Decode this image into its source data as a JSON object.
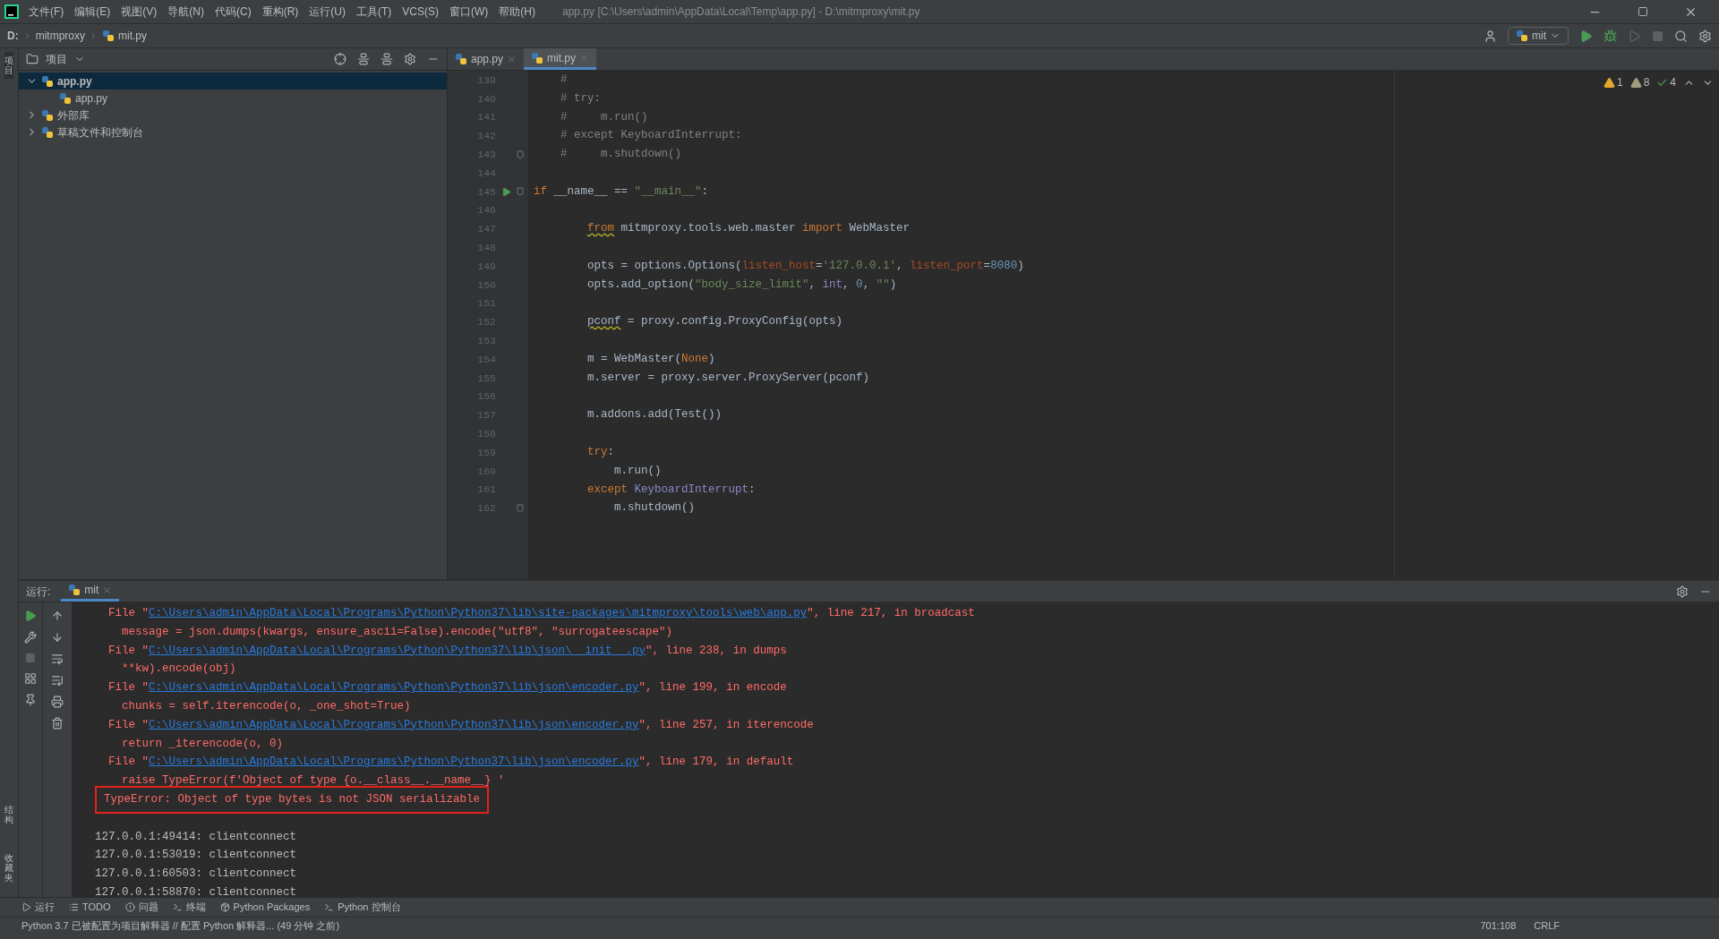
{
  "menu": [
    "文件(F)",
    "编辑(E)",
    "视图(V)",
    "导航(N)",
    "代码(C)",
    "重构(R)",
    "运行(U)",
    "工具(T)",
    "VCS(S)",
    "窗口(W)",
    "帮助(H)"
  ],
  "window": {
    "title": "app.py [C:\\Users\\admin\\AppData\\Local\\Temp\\app.py] - D:\\mitmproxy\\mit.py"
  },
  "breadcrumbs": [
    "D:",
    "mitmproxy",
    "mit.py"
  ],
  "run_config": "mit",
  "left_stripe": [
    {
      "label": "项目",
      "selected": true
    },
    {
      "label": "结构",
      "selected": false
    },
    {
      "label": "收藏夹",
      "selected": false
    }
  ],
  "project": {
    "title": "项目",
    "tree": [
      {
        "label": "app.py",
        "selected": true,
        "expanded": true,
        "children": [
          {
            "label": "app.py",
            "selected": false
          }
        ]
      },
      {
        "label": "外部库",
        "selected": false,
        "expanded": false
      },
      {
        "label": "草稿文件和控制台",
        "selected": false,
        "expanded": false
      }
    ]
  },
  "editor_tabs": [
    {
      "label": "app.py",
      "selected": false
    },
    {
      "label": "mit.py",
      "selected": true
    }
  ],
  "inspections": [
    {
      "kind": "warning",
      "count": "1"
    },
    {
      "kind": "weak",
      "count": "8"
    },
    {
      "kind": "typo",
      "count": "4"
    }
  ],
  "code": [
    {
      "number": "139",
      "kind": "level1",
      "run": false,
      "fold": false,
      "tokens": [
        {
          "kind": "comment",
          "text": "#"
        }
      ]
    },
    {
      "number": "140",
      "kind": "level1",
      "run": false,
      "fold": false,
      "tokens": [
        {
          "kind": "comment",
          "text": "# try:"
        }
      ]
    },
    {
      "number": "141",
      "kind": "level1",
      "run": false,
      "fold": false,
      "tokens": [
        {
          "kind": "comment",
          "text": "#     m.run()"
        }
      ]
    },
    {
      "number": "142",
      "kind": "level1",
      "run": false,
      "fold": false,
      "tokens": [
        {
          "kind": "comment",
          "text": "# except KeyboardInterrupt:"
        }
      ]
    },
    {
      "number": "143",
      "kind": "level1",
      "run": false,
      "fold": true,
      "tokens": [
        {
          "kind": "comment",
          "text": "#     m.shutdown()"
        }
      ]
    },
    {
      "number": "144",
      "kind": "top",
      "run": false,
      "fold": false
    },
    {
      "number": "145",
      "kind": "top",
      "run": true,
      "fold": true,
      "tokens": [
        {
          "kind": "keyword",
          "text": "if"
        },
        {
          "kind": "plain",
          "text": " __name__ == "
        },
        {
          "kind": "string",
          "text": "\"__main__\""
        },
        {
          "kind": "plain",
          "text": ":"
        }
      ]
    },
    {
      "number": "146",
      "kind": "top",
      "run": false,
      "fold": false
    },
    {
      "number": "147",
      "kind": "level2",
      "run": false,
      "fold": false,
      "tokens": [
        {
          "kind": "keyword",
          "text": "from",
          "warn": true
        },
        {
          "kind": "plain",
          "text": " mitmproxy.tools.web.master "
        },
        {
          "kind": "keyword",
          "text": "import"
        },
        {
          "kind": "plain",
          "text": " WebMaster"
        }
      ]
    },
    {
      "number": "148",
      "kind": "top",
      "run": false,
      "fold": false
    },
    {
      "number": "149",
      "kind": "level2",
      "run": false,
      "fold": false,
      "tokens": [
        {
          "kind": "plain",
          "text": "opts = options.Options("
        },
        {
          "kind": "param",
          "text": "listen_host"
        },
        {
          "kind": "plain",
          "text": "="
        },
        {
          "kind": "string",
          "text": "'127.0.0.1'"
        },
        {
          "kind": "plain",
          "text": ", "
        },
        {
          "kind": "param",
          "text": "listen_port"
        },
        {
          "kind": "plain",
          "text": "="
        },
        {
          "kind": "number",
          "text": "8080"
        },
        {
          "kind": "plain",
          "text": ")"
        }
      ]
    },
    {
      "number": "150",
      "kind": "level2",
      "run": false,
      "fold": false,
      "tokens": [
        {
          "kind": "plain",
          "text": "opts.add_option("
        },
        {
          "kind": "string",
          "text": "\"body_size_limit\""
        },
        {
          "kind": "plain",
          "text": ", "
        },
        {
          "kind": "builtin",
          "text": "int"
        },
        {
          "kind": "plain",
          "text": ", "
        },
        {
          "kind": "number",
          "text": "0"
        },
        {
          "kind": "plain",
          "text": ", "
        },
        {
          "kind": "string",
          "text": "\"\""
        },
        {
          "kind": "plain",
          "text": ")"
        }
      ]
    },
    {
      "number": "151",
      "kind": "top",
      "run": false,
      "fold": false
    },
    {
      "number": "152",
      "kind": "level2",
      "run": false,
      "fold": false,
      "tokens": [
        {
          "kind": "plain",
          "text": "pconf",
          "warn": true
        },
        {
          "kind": "plain",
          "text": " = proxy.config.ProxyConfig(opts)"
        }
      ]
    },
    {
      "number": "153",
      "kind": "top",
      "run": false,
      "fold": false
    },
    {
      "number": "154",
      "kind": "level2",
      "run": false,
      "fold": false,
      "tokens": [
        {
          "kind": "plain",
          "text": "m = WebMaster("
        },
        {
          "kind": "keyword",
          "text": "None"
        },
        {
          "kind": "plain",
          "text": ")"
        }
      ]
    },
    {
      "number": "155",
      "kind": "level2",
      "run": false,
      "fold": false,
      "tokens": [
        {
          "kind": "plain",
          "text": "m.server = proxy.server.ProxyServer(pconf)"
        }
      ]
    },
    {
      "number": "156",
      "kind": "top",
      "run": false,
      "fold": false
    },
    {
      "number": "157",
      "kind": "level2",
      "run": false,
      "fold": false,
      "tokens": [
        {
          "kind": "plain",
          "text": "m.addons.add(Test())"
        }
      ]
    },
    {
      "number": "158",
      "kind": "top",
      "run": false,
      "fold": false
    },
    {
      "number": "159",
      "kind": "level2",
      "run": false,
      "fold": false,
      "tokens": [
        {
          "kind": "keyword",
          "text": "try"
        },
        {
          "kind": "plain",
          "text": ":"
        }
      ]
    },
    {
      "number": "160",
      "kind": "level3",
      "run": false,
      "fold": false,
      "tokens": [
        {
          "kind": "plain",
          "text": "m.run()"
        }
      ]
    },
    {
      "number": "161",
      "kind": "level2",
      "run": false,
      "fold": false,
      "tokens": [
        {
          "kind": "keyword",
          "text": "except"
        },
        {
          "kind": "builtin",
          "text": " KeyboardInterrupt"
        },
        {
          "kind": "plain",
          "text": ":"
        }
      ]
    },
    {
      "number": "162",
      "kind": "level3",
      "run": false,
      "fold": true,
      "tokens": [
        {
          "kind": "plain",
          "text": "m.shutdown()"
        }
      ]
    }
  ],
  "run_panel": {
    "label": "运行:",
    "tab": "mit",
    "console": [
      {
        "kind": "file",
        "before": "File \"",
        "link": "C:\\Users\\admin\\AppData\\Local\\Programs\\Python\\Python37\\lib\\site-packages\\mitmproxy\\tools\\web\\app.py",
        "after": "\", line 217, in broadcast"
      },
      {
        "kind": "error",
        "text": "message = json.dumps(kwargs, ensure_ascii=False).encode(\"utf8\", \"surrogateescape\")"
      },
      {
        "kind": "file",
        "before": "File \"",
        "link": "C:\\Users\\admin\\AppData\\Local\\Programs\\Python\\Python37\\lib\\json\\__init__.py",
        "after": "\", line 238, in dumps"
      },
      {
        "kind": "error",
        "text": "**kw).encode(obj)"
      },
      {
        "kind": "file",
        "before": "File \"",
        "link": "C:\\Users\\admin\\AppData\\Local\\Programs\\Python\\Python37\\lib\\json\\encoder.py",
        "after": "\", line 199, in encode"
      },
      {
        "kind": "error",
        "text": "chunks = self.iterencode(o, _one_shot=True)"
      },
      {
        "kind": "file",
        "before": "File \"",
        "link": "C:\\Users\\admin\\AppData\\Local\\Programs\\Python\\Python37\\lib\\json\\encoder.py",
        "after": "\", line 257, in iterencode"
      },
      {
        "kind": "error",
        "text": "return _iterencode(o, 0)"
      },
      {
        "kind": "file",
        "before": "File \"",
        "link": "C:\\Users\\admin\\AppData\\Local\\Programs\\Python\\Python37\\lib\\json\\encoder.py",
        "after": "\", line 179, in default"
      },
      {
        "kind": "error",
        "text": "raise TypeError(f'Object of type {o.__class__.__name__} '"
      },
      {
        "kind": "highlight",
        "text": "TypeError: Object of type bytes is not JSON serializable"
      },
      {
        "kind": "blank"
      },
      {
        "kind": "log",
        "text": "127.0.0.1:49414: clientconnect"
      },
      {
        "kind": "log",
        "text": "127.0.0.1:53019: clientconnect"
      },
      {
        "kind": "log",
        "text": "127.0.0.1:60503: clientconnect"
      },
      {
        "kind": "log",
        "text": "127.0.0.1:58870: clientconnect"
      }
    ]
  },
  "bottom_tabs": [
    {
      "label": "运行",
      "kind": "run"
    },
    {
      "label": "TODO",
      "kind": "todo"
    },
    {
      "label": "问题",
      "kind": "problems"
    },
    {
      "label": "终端",
      "kind": "terminal"
    },
    {
      "label": "Python Packages",
      "kind": "packages"
    },
    {
      "label": "Python 控制台",
      "kind": "console"
    }
  ],
  "status_bar": {
    "message": "Python 3.7 已被配置为项目解释器 // 配置 Python 解释器... (49 分钟 之前)",
    "position": "701:108",
    "line_ending": "CRLF"
  }
}
